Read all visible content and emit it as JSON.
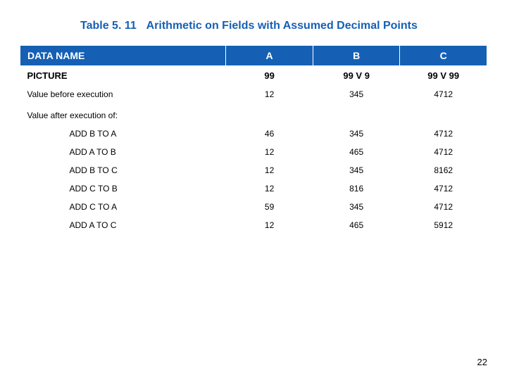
{
  "caption": {
    "label": "Table 5. 11",
    "title": "Arithmetic on Fields with Assumed Decimal Points"
  },
  "header": {
    "data_name": "DATA NAME",
    "a": "A",
    "b": "B",
    "c": "C"
  },
  "picture_row": {
    "label": "PICTURE",
    "a": "99",
    "b": "99 V 9",
    "c": "99 V 99"
  },
  "value_before": {
    "label": "Value before execution",
    "a": "12",
    "b": "345",
    "c": "4712"
  },
  "value_after_label": "Value after execution of:",
  "ops": [
    {
      "label": "ADD B TO A",
      "a": "46",
      "b": "345",
      "c": "4712"
    },
    {
      "label": "ADD A TO B",
      "a": "12",
      "b": "465",
      "c": "4712"
    },
    {
      "label": "ADD B TO C",
      "a": "12",
      "b": "345",
      "c": "8162"
    },
    {
      "label": "ADD C TO B",
      "a": "12",
      "b": "816",
      "c": "4712"
    },
    {
      "label": "ADD C TO A",
      "a": "59",
      "b": "345",
      "c": "4712"
    },
    {
      "label": "ADD A TO C",
      "a": "12",
      "b": "465",
      "c": "5912"
    }
  ],
  "page_number": "22",
  "chart_data": {
    "type": "table",
    "title": "Table 5.11 Arithmetic on Fields with Assumed Decimal Points",
    "columns": [
      "DATA NAME",
      "A",
      "B",
      "C"
    ],
    "picture": {
      "A": "99",
      "B": "99V9",
      "C": "99V99"
    },
    "value_before_execution": {
      "A": 12,
      "B": 345,
      "C": 4712
    },
    "value_after_execution_of": {
      "ADD B TO A": {
        "A": 46,
        "B": 345,
        "C": 4712
      },
      "ADD A TO B": {
        "A": 12,
        "B": 465,
        "C": 4712
      },
      "ADD B TO C": {
        "A": 12,
        "B": 345,
        "C": 8162
      },
      "ADD C TO B": {
        "A": 12,
        "B": 816,
        "C": 4712
      },
      "ADD C TO A": {
        "A": 59,
        "B": 345,
        "C": 4712
      },
      "ADD A TO C": {
        "A": 12,
        "B": 465,
        "C": 5912
      }
    }
  }
}
